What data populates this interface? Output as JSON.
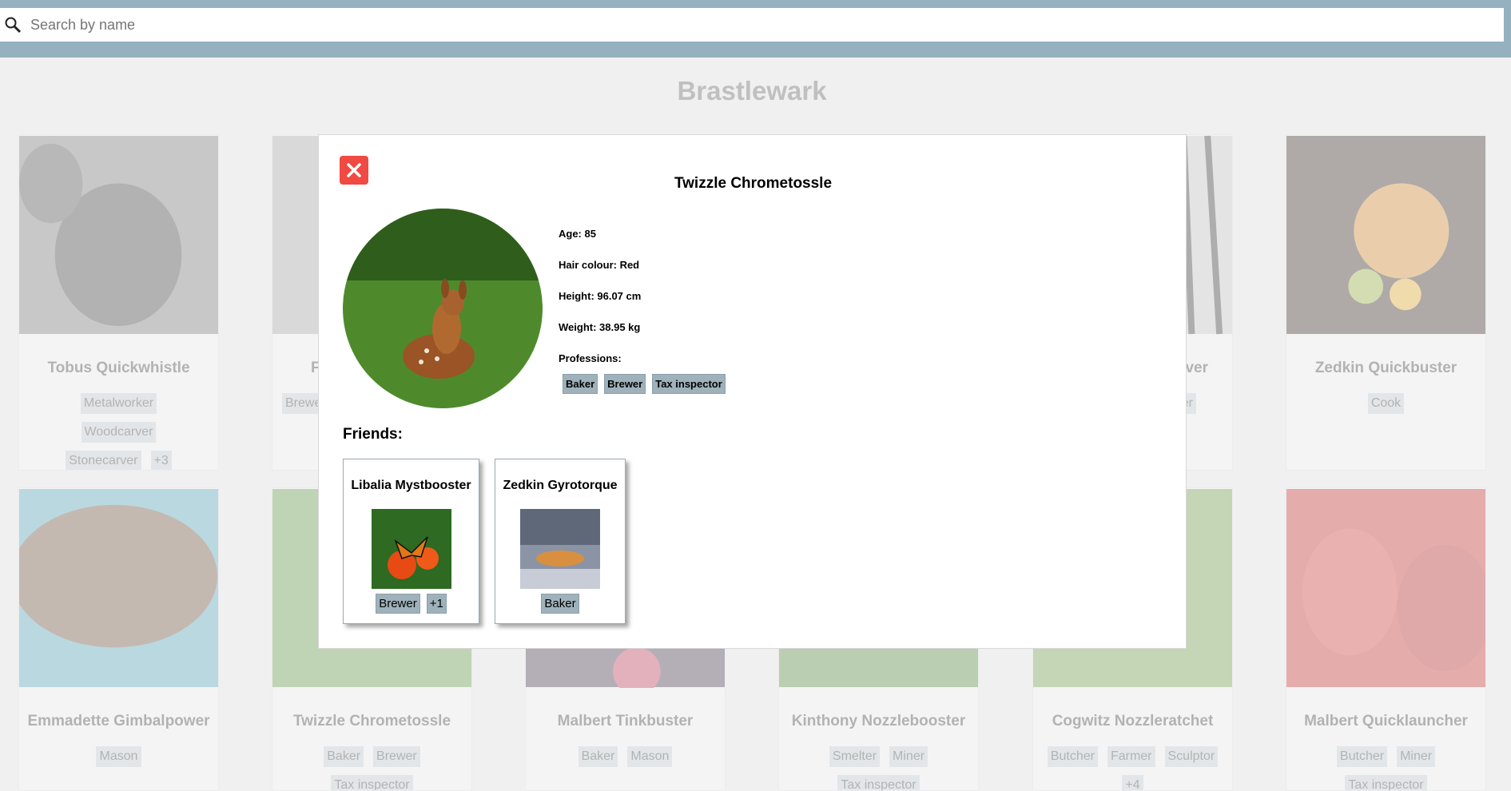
{
  "search": {
    "placeholder": "Search by name",
    "value": ""
  },
  "page_title": "Brastlewark",
  "cards": [
    {
      "name": "Tobus Quickwhistle",
      "tags": [
        "Metalworker",
        "Woodcarver",
        "Stonecarver",
        "+3"
      ]
    },
    {
      "name": "F",
      "tags": [
        "Brewe"
      ]
    },
    {
      "name": "ver",
      "tags": [
        "er"
      ]
    },
    {
      "name": "Zedkin Quickbuster",
      "tags": [
        "Cook"
      ]
    },
    {
      "name": "Emmadette Gimbalpower",
      "tags": [
        "Mason"
      ]
    },
    {
      "name": "Twizzle Chrometossle",
      "tags": [
        "Baker",
        "Brewer",
        "Tax inspector"
      ]
    },
    {
      "name": "Malbert Tinkbuster",
      "tags": [
        "Baker",
        "Mason"
      ]
    },
    {
      "name": "Kinthony Nozzlebooster",
      "tags": [
        "Smelter",
        "Miner",
        "Tax inspector"
      ]
    },
    {
      "name": "Cogwitz Nozzleratchet",
      "tags": [
        "Butcher",
        "Farmer",
        "Sculptor",
        "+4"
      ]
    },
    {
      "name": "Malbert Quicklauncher",
      "tags": [
        "Butcher",
        "Miner",
        "Tax inspector"
      ]
    }
  ],
  "modal": {
    "name": "Twizzle Chrometossle",
    "age": "Age: 85",
    "hair": "Hair colour: Red",
    "height": "Height: 96.07 cm",
    "weight": "Weight: 38.95 kg",
    "professions_label": "Professions:",
    "professions": [
      "Baker",
      "Brewer",
      "Tax inspector"
    ],
    "friends_label": "Friends:",
    "friends": [
      {
        "name": "Libalia Mystbooster",
        "tags": [
          "Brewer",
          "+1"
        ]
      },
      {
        "name": "Zedkin Gyrotorque",
        "tags": [
          "Baker"
        ]
      }
    ]
  },
  "colors": {
    "header": "#95b0bf",
    "close": "#f04a42",
    "tag": "#9fb2bb"
  }
}
